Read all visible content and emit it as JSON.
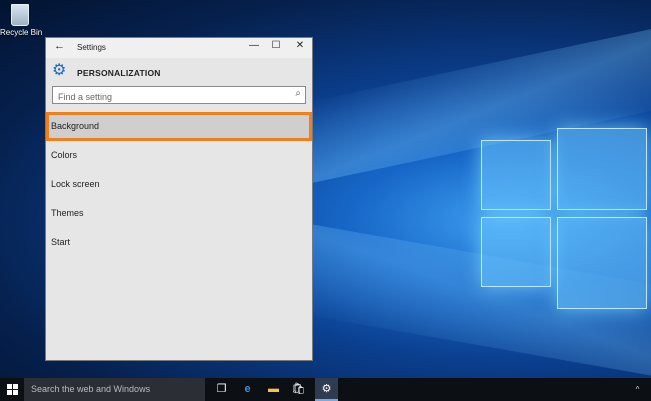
{
  "desktop": {
    "recycle_bin_label": "Recycle Bin"
  },
  "window": {
    "title": "Settings",
    "back_icon": "back-arrow-icon",
    "controls": {
      "minimize": "—",
      "maximize": "☐",
      "close": "✕"
    },
    "header_title": "PERSONALIZATION",
    "search": {
      "placeholder": "Find a setting",
      "value": ""
    },
    "menu": [
      {
        "label": "Background",
        "selected": true
      },
      {
        "label": "Colors",
        "selected": false
      },
      {
        "label": "Lock screen",
        "selected": false
      },
      {
        "label": "Themes",
        "selected": false
      },
      {
        "label": "Start",
        "selected": false
      }
    ],
    "highlight_color": "#f07f1e",
    "accent_color": "#1a6bc4"
  },
  "taskbar": {
    "search_text": "Search the web and Windows",
    "icons": [
      "task-view-icon",
      "edge-icon",
      "file-explorer-icon",
      "store-icon",
      "settings-icon"
    ]
  }
}
